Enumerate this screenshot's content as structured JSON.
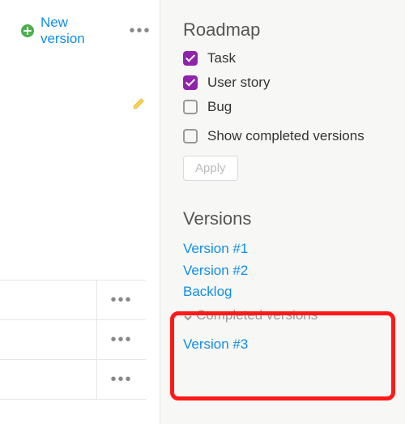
{
  "left": {
    "new_version_label": "New version",
    "rows_visible": 3
  },
  "roadmap": {
    "title": "Roadmap",
    "filters": [
      {
        "label": "Task",
        "checked": true
      },
      {
        "label": "User story",
        "checked": true
      },
      {
        "label": "Bug",
        "checked": false
      }
    ],
    "show_completed_label": "Show completed versions",
    "show_completed_checked": false,
    "apply_label": "Apply"
  },
  "versions": {
    "title": "Versions",
    "items": [
      "Version #1",
      "Version #2",
      "Backlog"
    ],
    "completed_toggle_label": "Completed versions",
    "completed_items": [
      "Version #3"
    ]
  }
}
